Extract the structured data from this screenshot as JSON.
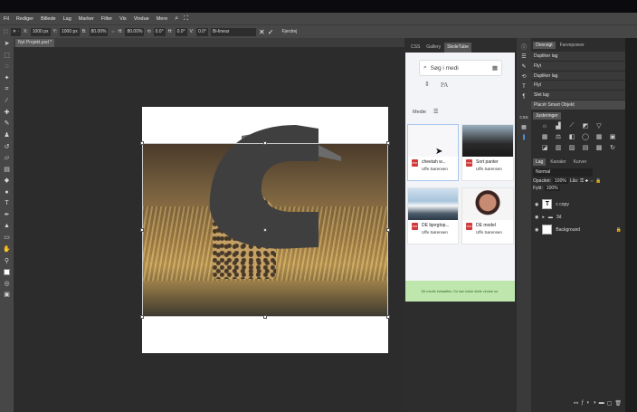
{
  "menu": {
    "items": [
      "Fil",
      "Rediger",
      "Billede",
      "Lag",
      "Marker",
      "Filter",
      "Vis",
      "Vindue",
      "Mere"
    ]
  },
  "options": {
    "x_label": "X:",
    "x_value": "1000 px",
    "y_label": "Y:",
    "y_value": "1000 px",
    "w_label": "B:",
    "w_value": "80.00%",
    "h_label": "H:",
    "h_value": "80.00%",
    "rot_value": "0.0°",
    "skew_h_label": "H:",
    "skew_h_value": "0.0°",
    "skew_v_label": "V:",
    "skew_v_value": "0.0°",
    "interp": "Bi-linear",
    "remove_label": "Fjerdrej"
  },
  "document": {
    "tab_label": "Nyt Projekt.psd *",
    "letter": "C"
  },
  "mid_panel": {
    "tabs": [
      "CSS",
      "Gallery",
      "SkoleTube"
    ],
    "search_placeholder": "Søg i medi",
    "pa_label": "PA",
    "media_label": "Medie",
    "cards": [
      {
        "title": "cheetah w...",
        "author": "Uffe Sørensen"
      },
      {
        "title": "Sort panter",
        "author": "Uffe Sørensen"
      },
      {
        "title": "DE bjergtop...",
        "author": "Uffe Sørensen"
      },
      {
        "title": "DE model",
        "author": "Uffe Sørensen"
      }
    ],
    "notice": "Dit medie indsættes. Du kan lukke dette vindue nu."
  },
  "right_panel": {
    "history_tabs": [
      "Oversigt",
      "Farveprøver"
    ],
    "history": [
      "Dupliker lag",
      "Flyt",
      "Dupliker lag",
      "Flyt",
      "Slet lag",
      "Placér Smart Objekt"
    ],
    "adjust_label": "Justeringer",
    "layer_tabs": [
      "Lag",
      "Kanaler",
      "Kurver"
    ],
    "blend_mode": "Normal",
    "opacity_label": "Opacitet:",
    "opacity_value": "100%",
    "lock_label": "Lås:",
    "fill_label": "Fyld:",
    "fill_value": "100%",
    "layers": [
      {
        "name": "c copy",
        "kind": "text"
      },
      {
        "name": "3d",
        "kind": "folder"
      },
      {
        "name": "Background",
        "kind": "image"
      }
    ]
  },
  "colors": {
    "accent": "#4a90d9",
    "notice_bg": "#bfe6ad",
    "pdf_red": "#d23a3a"
  }
}
